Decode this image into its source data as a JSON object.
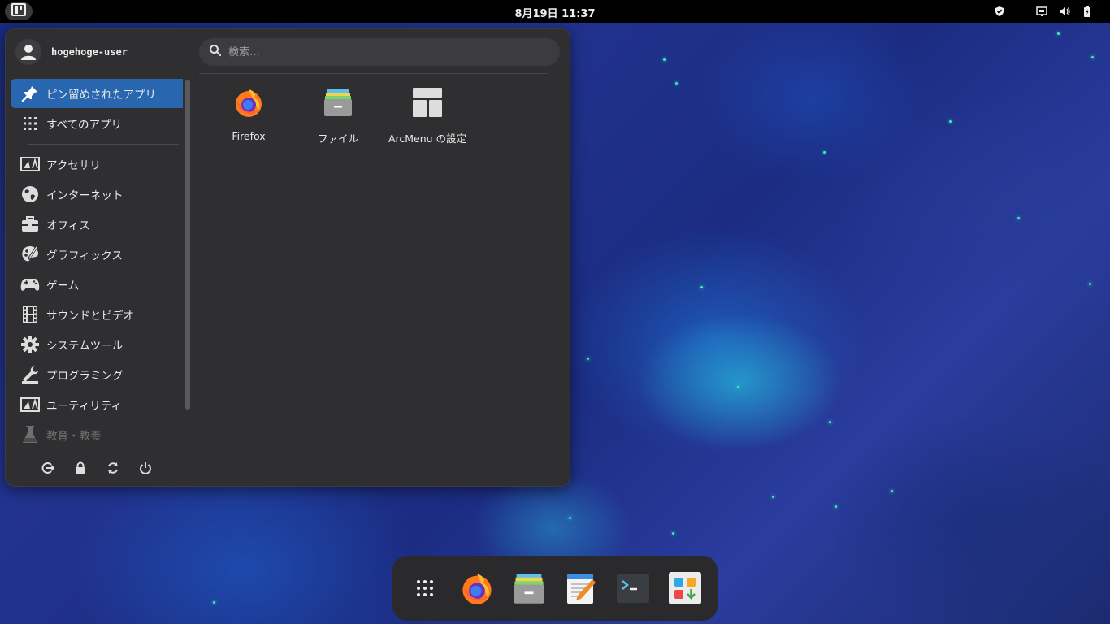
{
  "topbar": {
    "clock": "8月19日  11:37",
    "activities_icon": "zorin-logo-icon",
    "tray_icons": [
      "shield-icon",
      "network-icon",
      "volume-icon",
      "battery-icon"
    ]
  },
  "menu": {
    "username": "hogehoge-user",
    "search_placeholder": "検索…",
    "sidebar": {
      "pinned": "ピン留めされたアプリ",
      "all_apps": "すべてのアプリ",
      "categories": [
        {
          "label": "アクセサリ",
          "icon": "accessories-icon"
        },
        {
          "label": "インターネット",
          "icon": "globe-icon"
        },
        {
          "label": "オフィス",
          "icon": "briefcase-icon"
        },
        {
          "label": "グラフィックス",
          "icon": "palette-icon"
        },
        {
          "label": "ゲーム",
          "icon": "gamepad-icon"
        },
        {
          "label": "サウンドとビデオ",
          "icon": "film-icon"
        },
        {
          "label": "システムツール",
          "icon": "gear-icon"
        },
        {
          "label": "プログラミング",
          "icon": "wrench-icon"
        },
        {
          "label": "ユーティリティ",
          "icon": "utilities-icon"
        },
        {
          "label": "教育・教養",
          "icon": "flask-icon"
        }
      ]
    },
    "pinned_apps": [
      {
        "label": "Firefox",
        "icon": "firefox-icon"
      },
      {
        "label": "ファイル",
        "icon": "files-icon"
      },
      {
        "label": "ArcMenu の設定",
        "icon": "arcmenu-settings-icon"
      }
    ],
    "power_buttons": [
      "logout-icon",
      "lock-icon",
      "restart-icon",
      "power-icon"
    ]
  },
  "dock": {
    "items": [
      "app-grid-icon",
      "firefox-icon",
      "files-icon",
      "text-editor-icon",
      "terminal-icon",
      "software-icon"
    ]
  },
  "colors": {
    "accent": "#2866b0",
    "panel": "#2f2f31",
    "topbar": "#000000"
  }
}
